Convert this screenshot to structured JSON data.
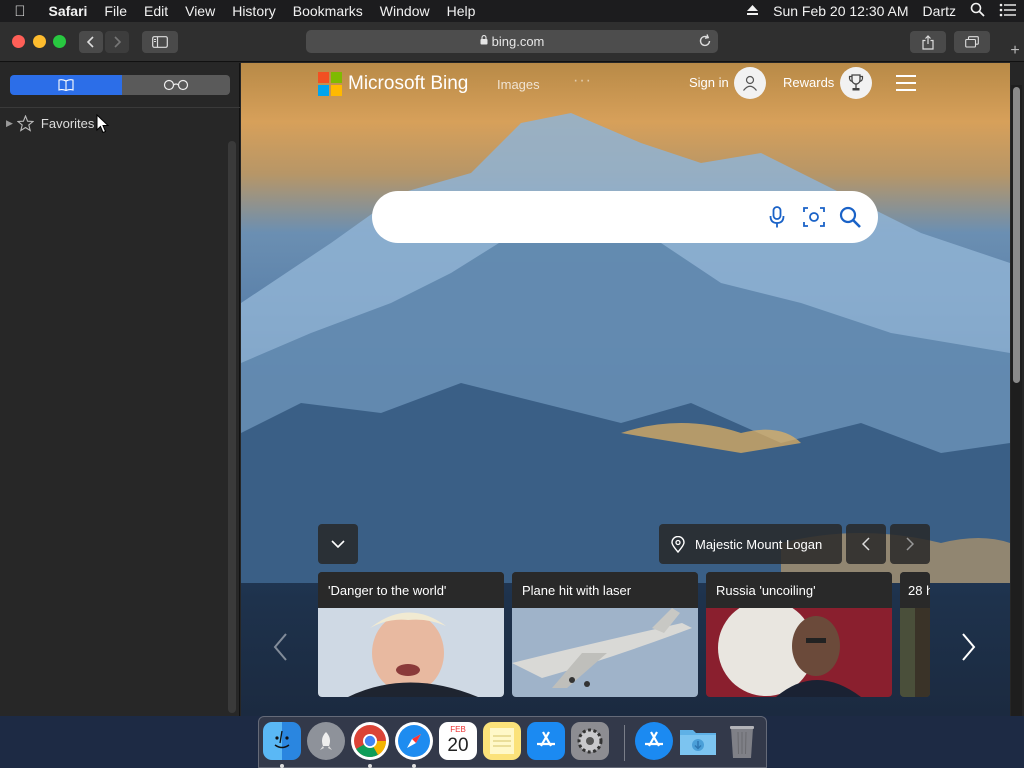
{
  "menubar": {
    "app": "Safari",
    "items": [
      "File",
      "Edit",
      "View",
      "History",
      "Bookmarks",
      "Window",
      "Help"
    ],
    "clock": "Sun Feb 20  12:30 AM",
    "user": "Dartz"
  },
  "browser": {
    "url": "bing.com"
  },
  "sidebar": {
    "favorites_label": "Favorites"
  },
  "bing": {
    "logo_text": "Microsoft Bing",
    "images_link": "Images",
    "more_dots": "···",
    "sign_in": "Sign in",
    "rewards": "Rewards",
    "location": "Majestic Mount Logan",
    "cards": [
      {
        "title": "'Danger to the world'"
      },
      {
        "title": "Plane hit with laser"
      },
      {
        "title": "Russia 'uncoiling'"
      },
      {
        "title": "28 h"
      }
    ]
  },
  "dock": {
    "calendar_month": "FEB",
    "calendar_day": "20"
  },
  "colors": {
    "accent": "#2c6ee8",
    "ms_red": "#f25022",
    "ms_green": "#7fba00",
    "ms_blue": "#00a4ef",
    "ms_yellow": "#ffb900"
  }
}
